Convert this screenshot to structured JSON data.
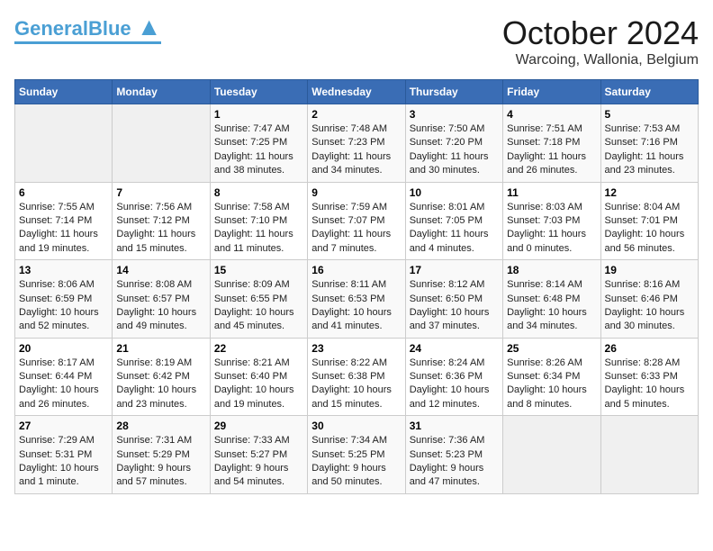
{
  "header": {
    "logo_general": "General",
    "logo_blue": "Blue",
    "month_title": "October 2024",
    "subtitle": "Warcoing, Wallonia, Belgium"
  },
  "days_of_week": [
    "Sunday",
    "Monday",
    "Tuesday",
    "Wednesday",
    "Thursday",
    "Friday",
    "Saturday"
  ],
  "weeks": [
    [
      {
        "day": "",
        "info": ""
      },
      {
        "day": "",
        "info": ""
      },
      {
        "day": "1",
        "info": "Sunrise: 7:47 AM\nSunset: 7:25 PM\nDaylight: 11 hours and 38 minutes."
      },
      {
        "day": "2",
        "info": "Sunrise: 7:48 AM\nSunset: 7:23 PM\nDaylight: 11 hours and 34 minutes."
      },
      {
        "day": "3",
        "info": "Sunrise: 7:50 AM\nSunset: 7:20 PM\nDaylight: 11 hours and 30 minutes."
      },
      {
        "day": "4",
        "info": "Sunrise: 7:51 AM\nSunset: 7:18 PM\nDaylight: 11 hours and 26 minutes."
      },
      {
        "day": "5",
        "info": "Sunrise: 7:53 AM\nSunset: 7:16 PM\nDaylight: 11 hours and 23 minutes."
      }
    ],
    [
      {
        "day": "6",
        "info": "Sunrise: 7:55 AM\nSunset: 7:14 PM\nDaylight: 11 hours and 19 minutes."
      },
      {
        "day": "7",
        "info": "Sunrise: 7:56 AM\nSunset: 7:12 PM\nDaylight: 11 hours and 15 minutes."
      },
      {
        "day": "8",
        "info": "Sunrise: 7:58 AM\nSunset: 7:10 PM\nDaylight: 11 hours and 11 minutes."
      },
      {
        "day": "9",
        "info": "Sunrise: 7:59 AM\nSunset: 7:07 PM\nDaylight: 11 hours and 7 minutes."
      },
      {
        "day": "10",
        "info": "Sunrise: 8:01 AM\nSunset: 7:05 PM\nDaylight: 11 hours and 4 minutes."
      },
      {
        "day": "11",
        "info": "Sunrise: 8:03 AM\nSunset: 7:03 PM\nDaylight: 11 hours and 0 minutes."
      },
      {
        "day": "12",
        "info": "Sunrise: 8:04 AM\nSunset: 7:01 PM\nDaylight: 10 hours and 56 minutes."
      }
    ],
    [
      {
        "day": "13",
        "info": "Sunrise: 8:06 AM\nSunset: 6:59 PM\nDaylight: 10 hours and 52 minutes."
      },
      {
        "day": "14",
        "info": "Sunrise: 8:08 AM\nSunset: 6:57 PM\nDaylight: 10 hours and 49 minutes."
      },
      {
        "day": "15",
        "info": "Sunrise: 8:09 AM\nSunset: 6:55 PM\nDaylight: 10 hours and 45 minutes."
      },
      {
        "day": "16",
        "info": "Sunrise: 8:11 AM\nSunset: 6:53 PM\nDaylight: 10 hours and 41 minutes."
      },
      {
        "day": "17",
        "info": "Sunrise: 8:12 AM\nSunset: 6:50 PM\nDaylight: 10 hours and 37 minutes."
      },
      {
        "day": "18",
        "info": "Sunrise: 8:14 AM\nSunset: 6:48 PM\nDaylight: 10 hours and 34 minutes."
      },
      {
        "day": "19",
        "info": "Sunrise: 8:16 AM\nSunset: 6:46 PM\nDaylight: 10 hours and 30 minutes."
      }
    ],
    [
      {
        "day": "20",
        "info": "Sunrise: 8:17 AM\nSunset: 6:44 PM\nDaylight: 10 hours and 26 minutes."
      },
      {
        "day": "21",
        "info": "Sunrise: 8:19 AM\nSunset: 6:42 PM\nDaylight: 10 hours and 23 minutes."
      },
      {
        "day": "22",
        "info": "Sunrise: 8:21 AM\nSunset: 6:40 PM\nDaylight: 10 hours and 19 minutes."
      },
      {
        "day": "23",
        "info": "Sunrise: 8:22 AM\nSunset: 6:38 PM\nDaylight: 10 hours and 15 minutes."
      },
      {
        "day": "24",
        "info": "Sunrise: 8:24 AM\nSunset: 6:36 PM\nDaylight: 10 hours and 12 minutes."
      },
      {
        "day": "25",
        "info": "Sunrise: 8:26 AM\nSunset: 6:34 PM\nDaylight: 10 hours and 8 minutes."
      },
      {
        "day": "26",
        "info": "Sunrise: 8:28 AM\nSunset: 6:33 PM\nDaylight: 10 hours and 5 minutes."
      }
    ],
    [
      {
        "day": "27",
        "info": "Sunrise: 7:29 AM\nSunset: 5:31 PM\nDaylight: 10 hours and 1 minute."
      },
      {
        "day": "28",
        "info": "Sunrise: 7:31 AM\nSunset: 5:29 PM\nDaylight: 9 hours and 57 minutes."
      },
      {
        "day": "29",
        "info": "Sunrise: 7:33 AM\nSunset: 5:27 PM\nDaylight: 9 hours and 54 minutes."
      },
      {
        "day": "30",
        "info": "Sunrise: 7:34 AM\nSunset: 5:25 PM\nDaylight: 9 hours and 50 minutes."
      },
      {
        "day": "31",
        "info": "Sunrise: 7:36 AM\nSunset: 5:23 PM\nDaylight: 9 hours and 47 minutes."
      },
      {
        "day": "",
        "info": ""
      },
      {
        "day": "",
        "info": ""
      }
    ]
  ]
}
